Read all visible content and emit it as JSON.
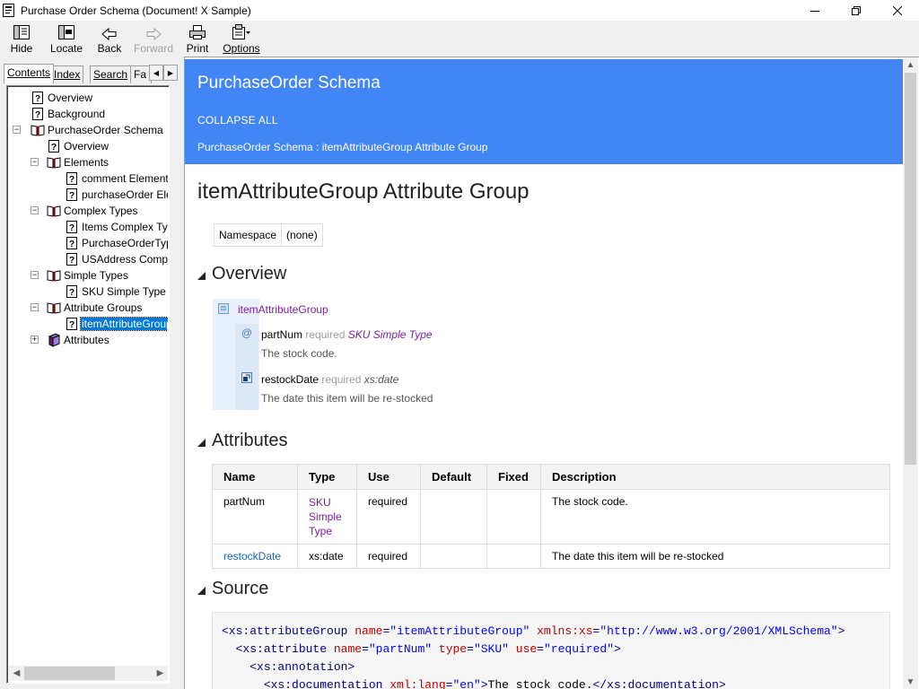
{
  "window": {
    "title": "Purchase Order Schema (Document! X Sample)"
  },
  "toolbar": {
    "hide": "Hide",
    "locate": "Locate",
    "back": "Back",
    "forward": "Forward",
    "print": "Print",
    "options": "Options"
  },
  "tabs": [
    "Contents",
    "Index",
    "Search",
    "Fa"
  ],
  "tree": {
    "overview": "Overview",
    "background": "Background",
    "schema": "PurchaseOrder Schema",
    "schema_overview": "Overview",
    "elements": "Elements",
    "comment_element": "comment Element",
    "purchaseorder_element": "purchaseOrder Element",
    "complex_types": "Complex Types",
    "items_complex": "Items Complex Type",
    "purchaseordertype": "PurchaseOrderType",
    "usaddress": "USAddress Complex Type",
    "simple_types": "Simple Types",
    "sku_simple": "SKU Simple Type",
    "attribute_groups": "Attribute Groups",
    "itemattributegroup": "itemAttributeGroup",
    "attributes": "Attributes"
  },
  "header": {
    "title": "PurchaseOrder Schema",
    "collapse_all": "COLLAPSE ALL",
    "breadcrumb": "PurchaseOrder Schema : itemAttributeGroup Attribute Group"
  },
  "page": {
    "heading": "itemAttributeGroup Attribute Group",
    "namespace_label": "Namespace",
    "namespace_value": "(none)",
    "overview_heading": "Overview",
    "attributes_heading": "Attributes",
    "source_heading": "Source"
  },
  "overview": {
    "group_name": "itemAttributeGroup",
    "items": [
      {
        "name": "partNum",
        "use": "required",
        "type": "SKU Simple Type",
        "desc": "The stock code."
      },
      {
        "name": "restockDate",
        "use": "required",
        "type": "xs:date",
        "desc": "The date this item will be re-stocked"
      }
    ]
  },
  "attributes_table": {
    "headers": [
      "Name",
      "Type",
      "Use",
      "Default",
      "Fixed",
      "Description"
    ],
    "rows": [
      {
        "name": "partNum",
        "type": "SKU Simple Type",
        "use": "required",
        "default": "",
        "fixed": "",
        "description": "The stock code."
      },
      {
        "name": "restockDate",
        "type": "xs:date",
        "use": "required",
        "default": "",
        "fixed": "",
        "description": "The date this item will be re-stocked"
      }
    ]
  },
  "source": {
    "line1": {
      "tag": "<xs:attributeGroup",
      "a1": "name",
      "v1": "\"itemAttributeGroup\"",
      "a2": "xmlns:xs",
      "v2": "\"http://www.w3.org/2001/XMLSchema\"",
      "end": ">"
    },
    "line2": {
      "tag": "<xs:attribute",
      "a1": "name",
      "v1": "\"partNum\"",
      "a2": "type",
      "v2": "\"SKU\"",
      "a3": "use",
      "v3": "\"required\"",
      "end": ">"
    },
    "line3": {
      "tag": "<xs:annotation>"
    },
    "line4": {
      "tag": "<xs:documentation",
      "a1": "xml:lang",
      "v1": "\"en\"",
      "text": "The stock code.",
      "close": "</xs:documentation>"
    }
  },
  "colors": {
    "header_bg": "#4285f4",
    "type_link": "#7b1fa2",
    "name_link": "#1a62b8"
  }
}
